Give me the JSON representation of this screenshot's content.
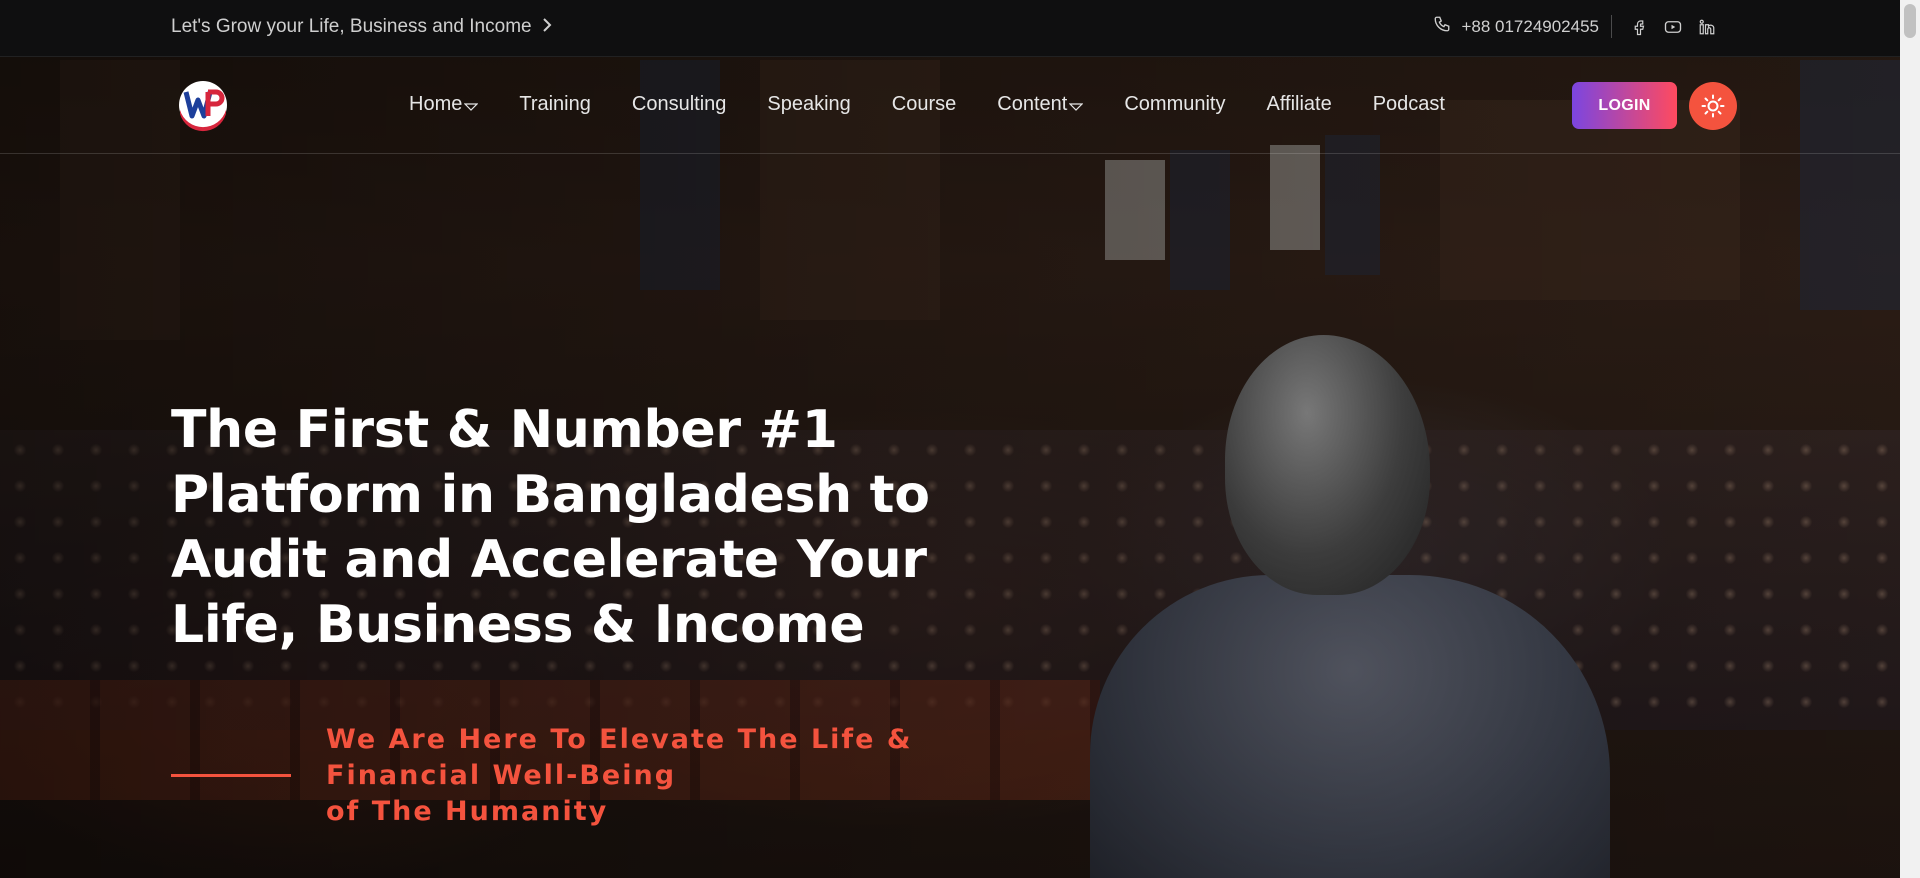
{
  "topbar": {
    "tagline": "Let's Grow your Life, Business and Income",
    "phone": "+88 01724902455",
    "social_icons": [
      "facebook-icon",
      "youtube-icon",
      "linkedin-icon"
    ]
  },
  "nav": {
    "items": [
      {
        "label": "Home",
        "has_dropdown": true
      },
      {
        "label": "Training",
        "has_dropdown": false
      },
      {
        "label": "Consulting",
        "has_dropdown": false
      },
      {
        "label": "Speaking",
        "has_dropdown": false
      },
      {
        "label": "Course",
        "has_dropdown": false
      },
      {
        "label": "Content",
        "has_dropdown": true
      },
      {
        "label": "Community",
        "has_dropdown": false
      },
      {
        "label": "Affiliate",
        "has_dropdown": false
      },
      {
        "label": "Podcast",
        "has_dropdown": false
      }
    ],
    "login_label": "LOGIN"
  },
  "hero": {
    "headline": "The First & Number #1 Platform in Bangladesh to Audit and Accelerate Your Life, Business & Income",
    "subline_1": "We Are Here To Elevate The Life &",
    "subline_2": "Financial Well-Being",
    "subline_3": "of The Humanity"
  },
  "colors": {
    "accent": "#f4533e",
    "login_gradient_start": "#7b45e0",
    "login_gradient_end": "#ff4a5f",
    "topbar_bg": "#0f0f10"
  }
}
